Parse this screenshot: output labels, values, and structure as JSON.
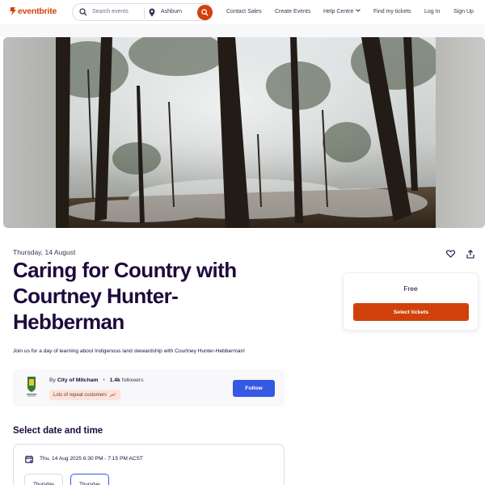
{
  "header": {
    "logo_text": "eventbrite",
    "search_placeholder": "Search events",
    "location": "Ashburn",
    "nav": {
      "contact_sales": "Contact Sales",
      "create_events": "Create Events",
      "help_centre": "Help Centre",
      "find_tickets": "Find my tickets",
      "log_in": "Log In",
      "sign_up": "Sign Up"
    }
  },
  "event": {
    "date": "Thursday, 14 August",
    "title": "Caring for Country with Courtney Hunter-Hebberman",
    "summary": "Join us for a day of learning about Indigenous land stewardship with Courtney Hunter-Hebberman!"
  },
  "ticket": {
    "price": "Free",
    "cta": "Select tickets"
  },
  "organizer": {
    "by": "By",
    "name": "City of Mitcham",
    "followers": "1.4k",
    "followers_label": "followers",
    "badge": "Lots of repeat customers",
    "follow": "Follow"
  },
  "schedule": {
    "heading": "Select date and time",
    "selected": "Thu, 14 Aug 2025 6:30 PM - 7:15 PM ACST",
    "chips": [
      "Thursday",
      "Thursday"
    ]
  },
  "icons": [
    "eventbrite-logo-icon",
    "search-icon",
    "location-pin-icon",
    "chevron-down-icon",
    "heart-icon",
    "share-icon",
    "calendar-icon",
    "sparkle-icon"
  ],
  "colors": {
    "brand": "#d1410c",
    "primary_blue": "#3659e3",
    "text_dark": "#1e0a3c",
    "panel_bg": "#f8f7fa",
    "badge_bg": "#fbe3dc"
  }
}
